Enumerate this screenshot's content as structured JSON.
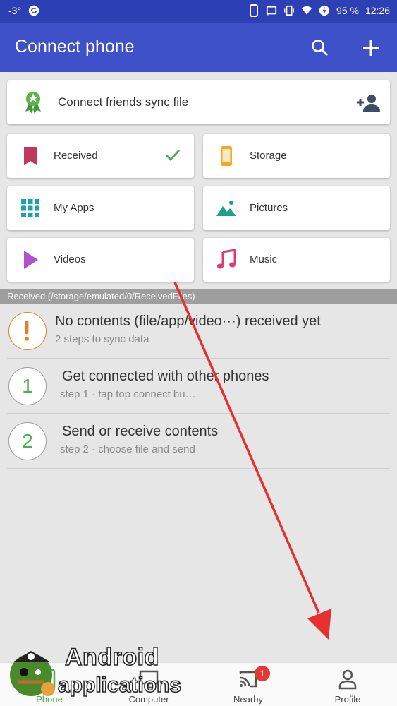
{
  "status_bar": {
    "left_text": "-3°",
    "battery": "95 %",
    "time": "12:26"
  },
  "app_bar": {
    "title": "Connect phone",
    "search_icon": "search-icon",
    "add_icon": "plus-icon",
    "color": "#3f51c8"
  },
  "banner": {
    "label": "Connect friends sync file",
    "icon": "ribbon-badge-icon",
    "action_icon": "add-person-icon"
  },
  "tiles": [
    {
      "label": "Received",
      "icon": "bookmark-icon",
      "color": "#c0395c",
      "checked": true
    },
    {
      "label": "Storage",
      "icon": "phone-icon",
      "color": "#f5a623"
    },
    {
      "label": "My Apps",
      "icon": "apps-grid-icon",
      "color": "#1aa0b8"
    },
    {
      "label": "Pictures",
      "icon": "landscape-icon",
      "color": "#1aa08c"
    },
    {
      "label": "Videos",
      "icon": "play-icon",
      "color": "#b44fd0"
    },
    {
      "label": "Music",
      "icon": "music-note-icon",
      "color": "#d83a7a"
    }
  ],
  "path_bar": "Received (/storage/emulated/0/ReceivedFiles)",
  "rows": [
    {
      "marker": "!",
      "title": "No contents (file/app/video···) received yet",
      "subtitle": "2 steps to sync data",
      "color": "#e2812a"
    },
    {
      "marker": "1",
      "title": "Get connected with other phones",
      "subtitle": "step 1 · tap top connect bu…",
      "color": "#4caf50"
    },
    {
      "marker": "2",
      "title": "Send or receive contents",
      "subtitle": "step 2 · choose file and send",
      "color": "#4caf50"
    }
  ],
  "bottom_nav": [
    {
      "label": "Phone",
      "icon": "phone-icon",
      "active": true
    },
    {
      "label": "Computer",
      "icon": "computer-icon"
    },
    {
      "label": "Nearby",
      "icon": "cast-icon",
      "badge": "1"
    },
    {
      "label": "Profile",
      "icon": "person-icon"
    }
  ],
  "watermark": {
    "line1": "Android",
    "line2": "applications"
  }
}
